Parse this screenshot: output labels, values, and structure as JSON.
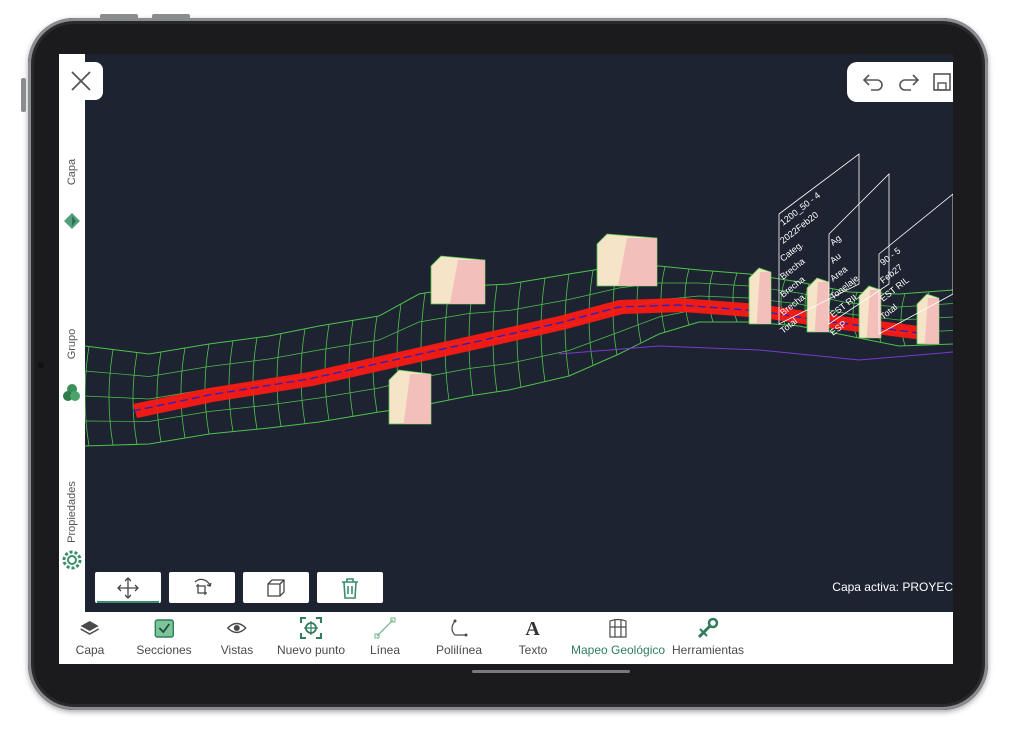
{
  "sidebar": {
    "items": [
      {
        "label": "Capa",
        "icon": "layers-icon"
      },
      {
        "label": "Grupo",
        "icon": "group-circles-icon"
      },
      {
        "label": "Propiedades",
        "icon": "gear-icon"
      }
    ]
  },
  "topbar": {
    "icons": [
      "undo-icon",
      "redo-icon",
      "save-icon"
    ]
  },
  "toolbar": {
    "tools": [
      "move-icon",
      "rotate-icon",
      "box-view-icon",
      "trash-icon"
    ],
    "active_tool": "move-icon"
  },
  "status": {
    "capa_activa": "Capa activa: PROYEC"
  },
  "bottombar": {
    "tabs": [
      {
        "label": "Capa",
        "icon": "layers-icon"
      },
      {
        "label": "Secciones",
        "icon": "sections-icon"
      },
      {
        "label": "Vistas",
        "icon": "eye-icon"
      },
      {
        "label": "Nuevo punto",
        "icon": "new-point-icon"
      },
      {
        "label": "Línea",
        "icon": "line-icon"
      },
      {
        "label": "Polilínea",
        "icon": "polyline-icon"
      },
      {
        "label": "Texto",
        "icon": "text-icon"
      },
      {
        "label": "Mapeo Geológico",
        "icon": "geologic-map-icon"
      },
      {
        "label": "Herramientas",
        "icon": "tools-icon"
      }
    ],
    "active_tab": "Mapeo Geológico"
  },
  "viewport": {
    "scene": "3D tunnel mesh",
    "colors": {
      "background": "#1d2331",
      "mesh": "#4fc24a",
      "floor": "#ff1a12",
      "centerline": "#2222cc",
      "accent": "#3a8f6a"
    },
    "label_panels": [
      {
        "lines": [
          "1200_50 - 4",
          "2022Feb20",
          "Categ.",
          "Brecha",
          "Brecha",
          "Brecha",
          "Total"
        ]
      },
      {
        "lines": [
          "Ag",
          "Au",
          "Area",
          "Tonelaje",
          "EST RIL",
          "ESP"
        ]
      },
      {
        "lines": [
          "90 - 5",
          "Feb27",
          "EST RIL",
          "Total"
        ]
      }
    ]
  }
}
